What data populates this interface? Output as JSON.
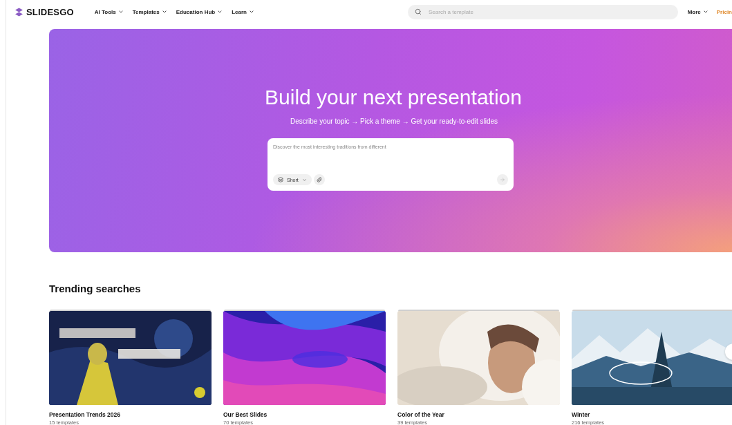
{
  "header": {
    "logo": "SLIDESGO",
    "nav": [
      {
        "label": "AI Tools"
      },
      {
        "label": "Templates"
      },
      {
        "label": "Education Hub"
      },
      {
        "label": "Learn"
      }
    ],
    "search": {
      "placeholder": "Search a template"
    },
    "more": "More",
    "pricing": "Pricin"
  },
  "hero": {
    "title": "Build your next presentation",
    "subtitle": "Describe your topic → Pick a theme → Get your ready-to-edit slides",
    "prompt": {
      "placeholder": "Discover the most interesting traditions from different"
    },
    "length": "Short"
  },
  "trending": {
    "title": "Trending searches",
    "cards": [
      {
        "title": "Presentation Trends 2026",
        "count": "15 templates"
      },
      {
        "title": "Our Best Slides",
        "count": "70 templates"
      },
      {
        "title": "Color of the Year",
        "count": "39 templates"
      },
      {
        "title": "Winter",
        "count": "216 templates"
      }
    ]
  }
}
